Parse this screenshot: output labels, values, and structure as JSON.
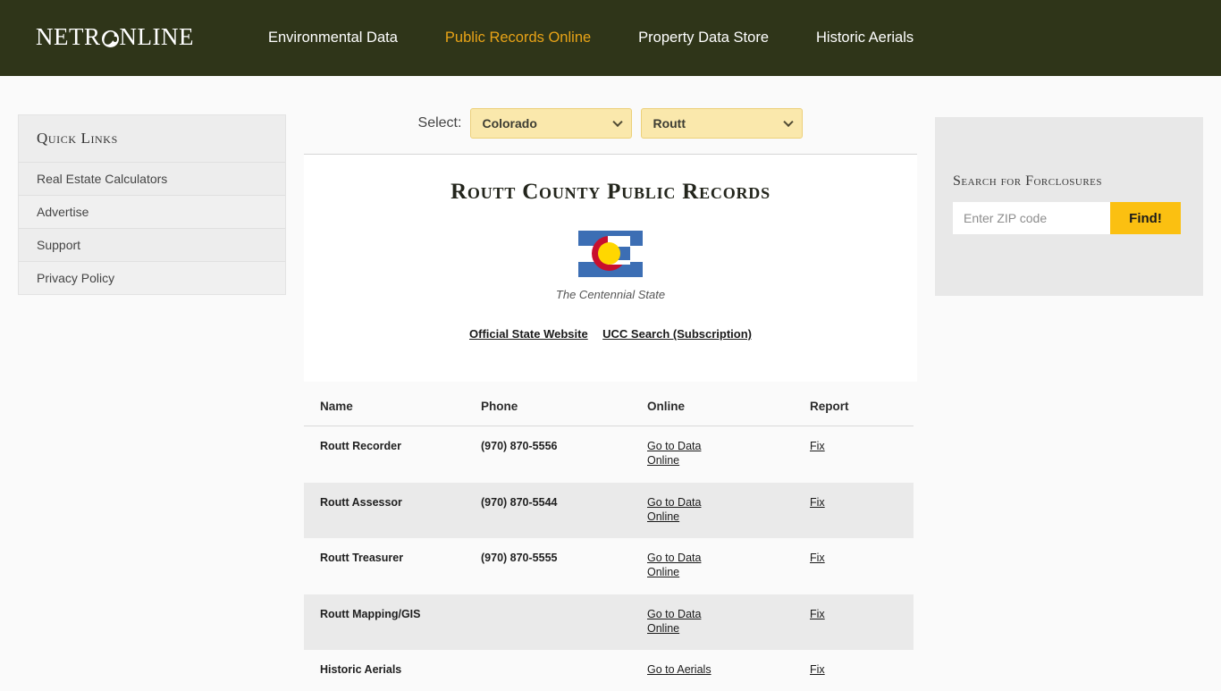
{
  "header": {
    "logo_text_before": "NETR",
    "logo_icon": "globe-icon",
    "logo_text_after": "NLINE",
    "nav": [
      {
        "label": "Environmental Data",
        "active": false
      },
      {
        "label": "Public Records Online",
        "active": true
      },
      {
        "label": "Property Data Store",
        "active": false
      },
      {
        "label": "Historic Aerials",
        "active": false
      }
    ],
    "brand_color": "#2f3519",
    "active_link_color": "#e8a317"
  },
  "sidebar": {
    "title": "Quick Links",
    "items": [
      {
        "label": "Real Estate Calculators"
      },
      {
        "label": "Advertise"
      },
      {
        "label": "Support"
      },
      {
        "label": "Privacy Policy"
      }
    ]
  },
  "selector": {
    "label": "Select:",
    "state_value": "Colorado",
    "county_value": "Routt",
    "background_color": "#fae8ac"
  },
  "main": {
    "title": "Routt County Public Records",
    "flag": {
      "alt": "colorado-state-flag",
      "caption": "The Centennial State",
      "blue": "#3c6eb4",
      "red": "#c8102e",
      "yellow": "#ffd700"
    },
    "state_links": [
      {
        "label": "Official State Website"
      },
      {
        "label": "UCC Search (Subscription)"
      }
    ]
  },
  "table": {
    "columns": [
      "Name",
      "Phone",
      "Online",
      "Report"
    ],
    "rows": [
      {
        "name": "Routt Recorder",
        "phone": "(970) 870-5556",
        "online": "Go to Data Online",
        "report": "Fix"
      },
      {
        "name": "Routt Assessor",
        "phone": "(970) 870-5544",
        "online": "Go to Data Online",
        "report": "Fix"
      },
      {
        "name": "Routt Treasurer",
        "phone": "(970) 870-5555",
        "online": "Go to Data Online",
        "report": "Fix"
      },
      {
        "name": "Routt Mapping/GIS",
        "phone": "",
        "online": "Go to Data Online",
        "report": "Fix"
      },
      {
        "name": "Historic Aerials",
        "phone": "",
        "online": "Go to Aerials",
        "report": "Fix"
      }
    ]
  },
  "foreclosure": {
    "title": "Search for Forclosures",
    "input_placeholder": "Enter ZIP code",
    "input_value": "",
    "button_label": "Find!",
    "button_color": "#fbc011"
  }
}
